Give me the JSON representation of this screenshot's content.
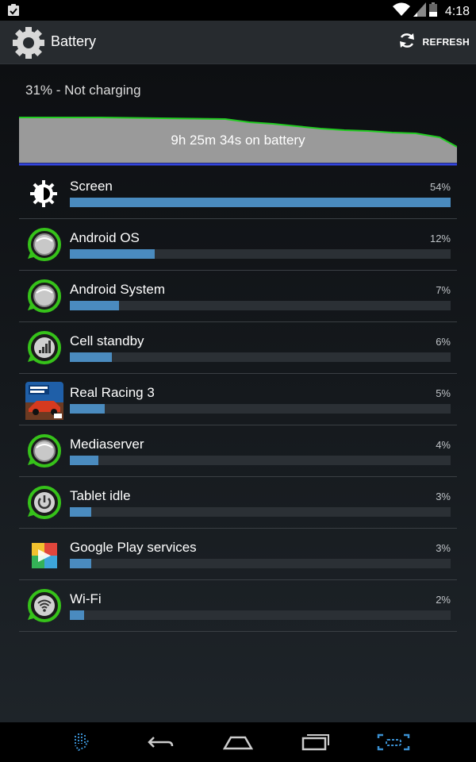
{
  "status_bar": {
    "time": "4:18"
  },
  "action_bar": {
    "title": "Battery",
    "refresh_label": "REFRESH"
  },
  "charge_status": "31% - Not charging",
  "history_graph": {
    "label": "9h 25m 34s on battery"
  },
  "usage": [
    {
      "name": "Screen",
      "percent_label": "54%",
      "percent": 54,
      "icon": "brightness-icon"
    },
    {
      "name": "Android OS",
      "percent_label": "12%",
      "percent": 12,
      "icon": "android-os-icon"
    },
    {
      "name": "Android System",
      "percent_label": "7%",
      "percent": 7,
      "icon": "android-system-icon"
    },
    {
      "name": "Cell standby",
      "percent_label": "6%",
      "percent": 6,
      "icon": "cell-signal-icon"
    },
    {
      "name": "Real Racing 3",
      "percent_label": "5%",
      "percent": 5,
      "icon": "real-racing-icon"
    },
    {
      "name": "Mediaserver",
      "percent_label": "4%",
      "percent": 4,
      "icon": "mediaserver-icon"
    },
    {
      "name": "Tablet idle",
      "percent_label": "3%",
      "percent": 3,
      "icon": "power-icon"
    },
    {
      "name": "Google Play services",
      "percent_label": "3%",
      "percent": 3,
      "icon": "play-services-icon"
    },
    {
      "name": "Wi-Fi",
      "percent_label": "2%",
      "percent": 2,
      "icon": "wifi-icon"
    }
  ],
  "colors": {
    "bar_fill": "#4a8bbf",
    "bar_track": "#2b3035",
    "graph_line": "#22cc22",
    "graph_fill": "#9a9a9a",
    "graph_baseline": "#3344dd"
  },
  "nav_bar": {
    "icons": [
      "gesture-icon",
      "back-icon",
      "home-icon",
      "recents-icon",
      "screenshot-icon"
    ]
  }
}
